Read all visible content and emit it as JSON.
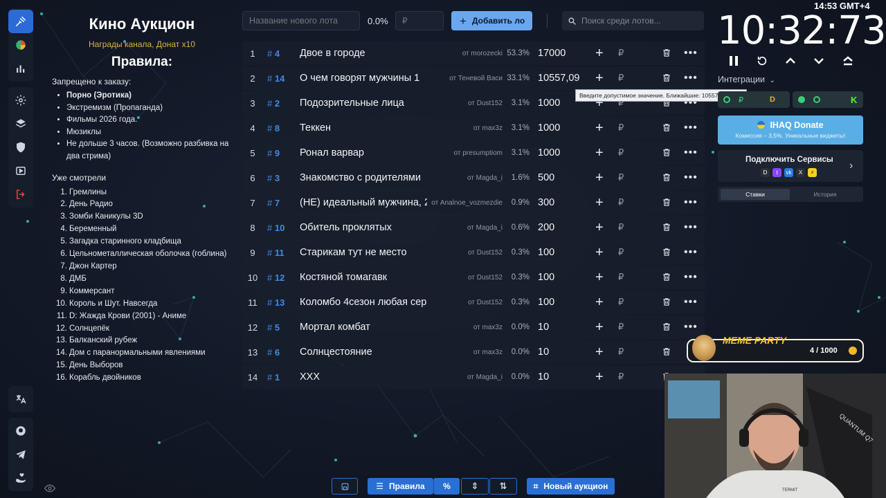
{
  "clock_small": "14:53 GMT+4",
  "rules": {
    "title": "Кино Аукцион",
    "subtitle": "Награды канала, Донат x10",
    "rules_title": "Правила:",
    "forbidden_title": "Запрещено к заказу:",
    "forbidden": [
      "Порно (Эротика)",
      "Экстремизм (Пропаганда)",
      "Фильмы 2026 года.",
      "Мюзиклы",
      "Не дольше 3 часов. (Возможно разбивка на два стрима)"
    ],
    "watched_title": "Уже смотрели",
    "watched": [
      {
        "n": "1.",
        "t": "Гремлины"
      },
      {
        "n": "2.",
        "t": "День Радио"
      },
      {
        "n": "3.",
        "t": "Зомби Каникулы 3D"
      },
      {
        "n": "4.",
        "t": "Беременный"
      },
      {
        "n": "5.",
        "t": "Загадка старинного кладбища"
      },
      {
        "n": "6.",
        "t": "Цельнометаллическая оболочка (гоблина)"
      },
      {
        "n": "7.",
        "t": "Джон Картер"
      },
      {
        "n": "8.",
        "t": "ДМБ"
      },
      {
        "n": "9.",
        "t": "Коммерсант"
      },
      {
        "n": "10.",
        "t": "Король и Шут. Навсегда"
      },
      {
        "n": "11.",
        "t": "D: Жажда Крови (2001) - Аниме"
      },
      {
        "n": "12.",
        "t": "Солнцепёк"
      },
      {
        "n": "13.",
        "t": "Балканский рубеж"
      },
      {
        "n": "14.",
        "t": "Дом с паранормальными явлениями"
      },
      {
        "n": "15.",
        "t": "День Выборов"
      },
      {
        "n": "16.",
        "t": "Корабль двойников"
      }
    ]
  },
  "toolbar": {
    "lot_placeholder": "Название нового лота",
    "percent": "0.0%",
    "amount_placeholder": "₽",
    "add_label": "Добавить ло",
    "search_placeholder": "Поиск среди лотов..."
  },
  "lots": [
    {
      "num": "1",
      "id": "4",
      "name": "Двое в городе",
      "author": "от morozecki",
      "share": "53.3%",
      "amount": "17000"
    },
    {
      "num": "2",
      "id": "14",
      "name": "О чем говорят мужчины 1",
      "author": "от Теневой Васи",
      "share": "33.1%",
      "amount": "10557,09"
    },
    {
      "num": "3",
      "id": "2",
      "name": "Подозрительные лица",
      "author": "от Dust152",
      "share": "3.1%",
      "amount": "1000"
    },
    {
      "num": "4",
      "id": "8",
      "name": "Теккен",
      "author": "от max3z",
      "share": "3.1%",
      "amount": "1000"
    },
    {
      "num": "5",
      "id": "9",
      "name": "Ронал варвар",
      "author": "от presumptiom",
      "share": "3.1%",
      "amount": "1000"
    },
    {
      "num": "6",
      "id": "3",
      "name": "Знакомство с родителями",
      "author": "от Magda_i",
      "share": "1.6%",
      "amount": "500"
    },
    {
      "num": "7",
      "id": "7",
      "name": "(НЕ) идеальный мужчина, 2",
      "author": "от Analnoe_vozmezdie",
      "share": "0.9%",
      "amount": "300"
    },
    {
      "num": "8",
      "id": "10",
      "name": "Обитель проклятых",
      "author": "от Magda_i",
      "share": "0.6%",
      "amount": "200"
    },
    {
      "num": "9",
      "id": "11",
      "name": "Старикам тут не место",
      "author": "от Dust152",
      "share": "0.3%",
      "amount": "100"
    },
    {
      "num": "10",
      "id": "12",
      "name": "Костяной томагавк",
      "author": "от Dust152",
      "share": "0.3%",
      "amount": "100"
    },
    {
      "num": "11",
      "id": "13",
      "name": "Коломбо 4сезон любая серия",
      "author": "от Dust152",
      "share": "0.3%",
      "amount": "100"
    },
    {
      "num": "12",
      "id": "5",
      "name": "Мортал комбат",
      "author": "от max3z",
      "share": "0.0%",
      "amount": "10"
    },
    {
      "num": "13",
      "id": "6",
      "name": "Солнцестояние",
      "author": "от max3z",
      "share": "0.0%",
      "amount": "10"
    },
    {
      "num": "14",
      "id": "1",
      "name": "XXX",
      "author": "от Magda_i",
      "share": "0.0%",
      "amount": "10"
    }
  ],
  "lot_hash": "#",
  "rub_symbol": "₽",
  "tooltip": "Введите допустимое значение. Ближайшие: 10557 и 10558.",
  "bottom": {
    "rules_label": "Правила",
    "percent_label": "%",
    "new_auction_label": "Новый аукцион"
  },
  "timer": {
    "display": "10:32:73"
  },
  "integrations_label": "Интеграции",
  "pay_pills": [
    "₽",
    "D",
    "K"
  ],
  "donate": {
    "title": "IHAQ Donate",
    "subtitle": "Комиссия – 3,5%. Уникальные виджеты!"
  },
  "services": {
    "title": "Подключить Сервисы"
  },
  "tabs": {
    "bets": "Ставки",
    "history": "История"
  },
  "meme": {
    "title": "MEME PARTY",
    "count": "4 / 1000"
  },
  "webcam_shirt_text": "TERMIT",
  "webcam_chair_text": "QUANTUM Q7",
  "colors": {
    "accent": "#2a6fd4",
    "id_blue": "#3f8ae6",
    "gold": "#e2b23a",
    "donate": "#5aaee6"
  }
}
